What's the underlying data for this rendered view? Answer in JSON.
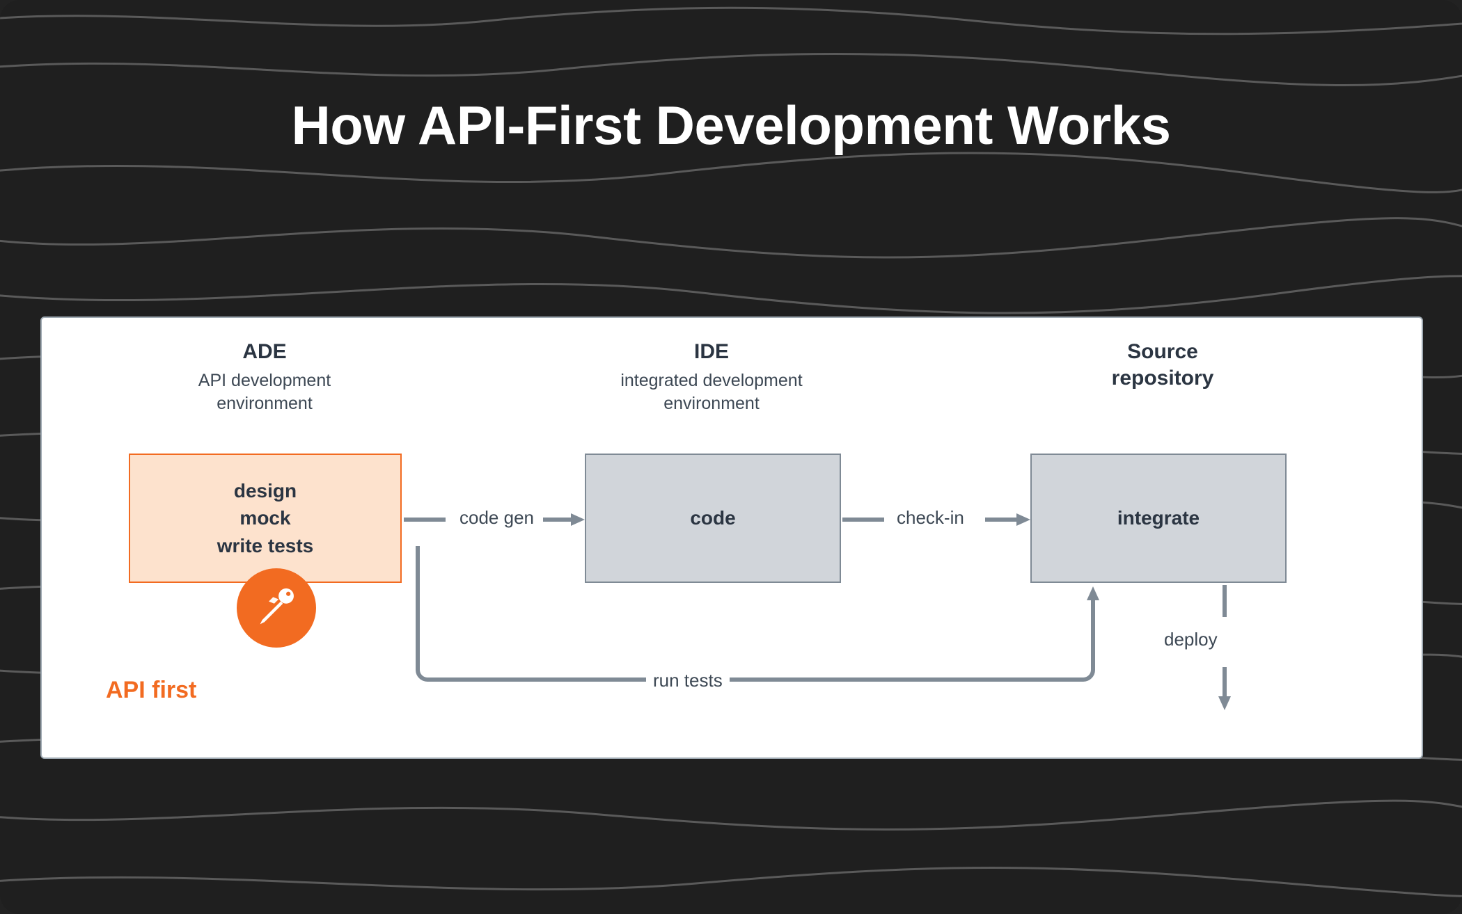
{
  "title": "How API-First Development Works",
  "columns": {
    "ade": {
      "heading": "ADE",
      "subheading": "API development\nenvironment"
    },
    "ide": {
      "heading": "IDE",
      "subheading": "integrated development\nenvironment"
    },
    "repo": {
      "heading": "Source\nrepository",
      "subheading": ""
    }
  },
  "boxes": {
    "ade_lines": [
      "design",
      "mock",
      "write tests"
    ],
    "ide_label": "code",
    "repo_label": "integrate"
  },
  "flows": {
    "code_gen": "code gen",
    "check_in": "check-in",
    "run_tests": "run tests",
    "deploy": "deploy"
  },
  "api_first_label": "API first",
  "colors": {
    "accent_orange": "#f26b21",
    "box_gray": "#d1d5da",
    "line_gray": "#7f8a95",
    "text_dark": "#2b3542"
  }
}
